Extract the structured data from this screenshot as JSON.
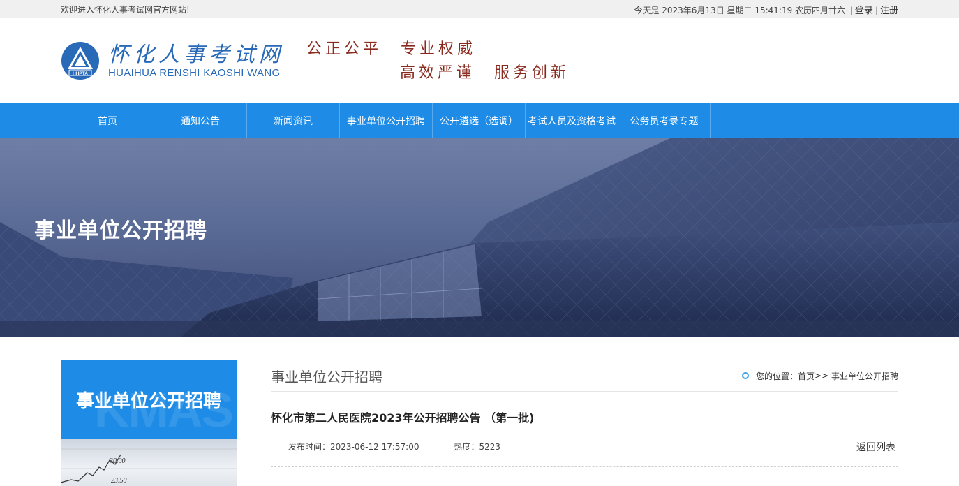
{
  "topbar": {
    "welcome": "欢迎进入怀化人事考试网官方网站!",
    "date_text": "今天是 2023年6月13日 星期二 15:41:19 农历四月廿六",
    "login": "登录",
    "register": "注册"
  },
  "header": {
    "logo_cn": "怀化人事考试网",
    "logo_en": "HUAIHUA RENSHI KAOSHI WANG",
    "logo_badge": "HHPTA",
    "slogan_line1": "公正公平　专业权威",
    "slogan_line2": "高效严谨　服务创新"
  },
  "nav": {
    "items": [
      {
        "label": "首页"
      },
      {
        "label": "通知公告"
      },
      {
        "label": "新闻资讯"
      },
      {
        "label": "事业单位公开招聘"
      },
      {
        "label": "公开遴选（选调）"
      },
      {
        "label": "考试人员及资格考试"
      },
      {
        "label": "公务员考录专题"
      }
    ]
  },
  "banner": {
    "title": "事业单位公开招聘"
  },
  "sidebar": {
    "title": "事业单位公开招聘",
    "watermark": "KMAS",
    "image_num1": "30.00",
    "image_num2": "23.50"
  },
  "main": {
    "section_title": "事业单位公开招聘",
    "breadcrumb_label": "您的位置：",
    "breadcrumb_home": "首页",
    "breadcrumb_sep": ">>",
    "breadcrumb_current": "事业单位公开招聘",
    "article_title": "怀化市第二人民医院2023年公开招聘公告 （第一批)",
    "publish_label": "发布时间：",
    "publish_time": "2023-06-12 17:57:00",
    "hot_label": "热度：",
    "hot_value": "5223",
    "back_label": "返回列表"
  },
  "colors": {
    "nav_blue": "#1e8ce6",
    "logo_blue": "#2869b8",
    "slogan_red": "#8a2a1e"
  },
  "icons": [
    "logo-emblem-icon",
    "breadcrumb-ring-icon"
  ]
}
